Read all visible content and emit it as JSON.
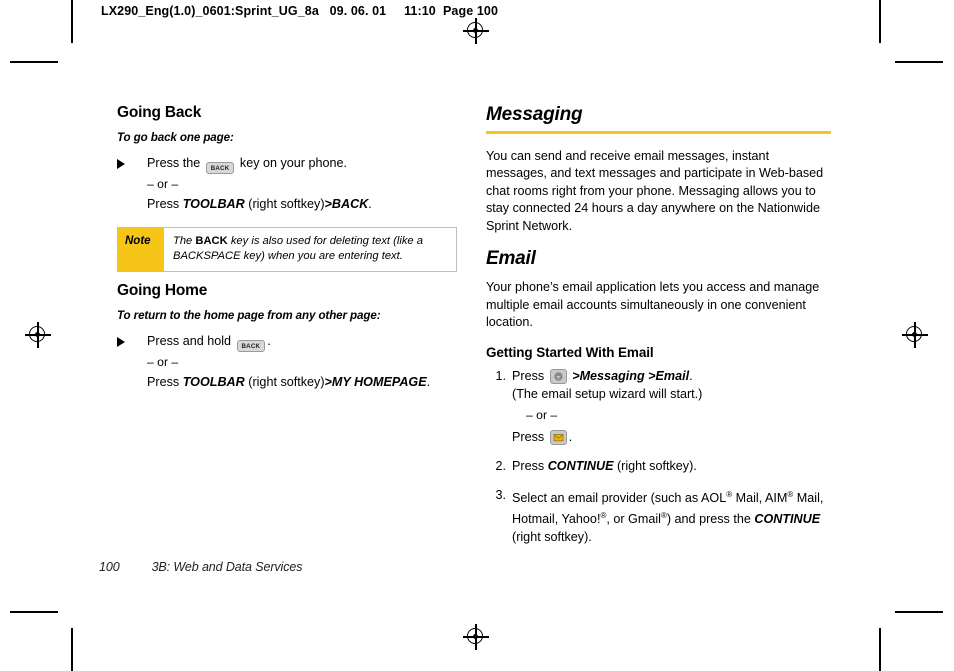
{
  "runhead": "LX290_Eng(1.0)_0601:Sprint_UG_8a   09. 06. 01     11:10  Page 100",
  "left_column": {
    "heading_going_back": "Going Back",
    "lead_going_back": "To go back one page:",
    "step1_pre": "Press the",
    "step1_key": "BACK",
    "step1_post": "key on your phone.",
    "or": "– or –",
    "step2_pre": "Press",
    "step2_italic1": "TOOLBAR",
    "step2_mid": "(right softkey)",
    "step2_gt": ">",
    "step2_italic2": "BACK",
    "step2_end": ".",
    "note": {
      "label": "Note",
      "text_1": "The ",
      "text_bold": "BACK",
      "text_2": " key is also used for deleting text (like a BACKSPACE key) when you are entering text."
    },
    "heading_going_home": "Going Home",
    "lead_going_home": "To return to the home page from any other page:",
    "home_step1_pre": "Press and hold",
    "home_step1_key": "BACK",
    "home_step1_post": ".",
    "home_step2_pre": "Press",
    "home_step2_italic1": "TOOLBAR",
    "home_step2_mid": "(right softkey)",
    "home_step2_gt": ">",
    "home_step2_italic2": "MY HOMEPAGE",
    "home_step2_end": "."
  },
  "right_column": {
    "heading_messaging": "Messaging",
    "messaging_body": "You can send and receive email messages, instant messages, and text messages and participate in Web-based chat rooms right from your phone. Messaging allows you to stay connected 24 hours a day anywhere on the Nationwide Sprint Network.",
    "heading_email": "Email",
    "email_body": "Your phone’s email application lets you access and manage multiple email accounts simultaneously in one convenient location.",
    "heading_getting_started": "Getting Started With Email",
    "steps": [
      {
        "num": "1.",
        "pre": "Press",
        "icon": "menu-key-icon",
        "gt1": ">",
        "italic1": "Messaging",
        "gt2": ">",
        "italic2": "Email",
        "end": ".",
        "line2": "(The email setup wizard will start.)",
        "or": "– or –",
        "line3_pre": "Press",
        "line3_icon": "email-key-icon",
        "line3_end": "."
      },
      {
        "num": "2.",
        "pre": "Press",
        "italic1": "CONTINUE",
        "post": "(right softkey)."
      },
      {
        "num": "3.",
        "text_a": "Select an email provider (such as AOL",
        "sup_a": "®",
        "text_b": " Mail, AIM",
        "sup_b": "®",
        "text_c": " Mail, Hotmail, Yahoo!",
        "sup_c": "®",
        "text_d": ", or Gmail",
        "sup_d": "®",
        "text_e": ") and press the ",
        "italic1": "CONTINUE",
        "text_f": " (right softkey)."
      }
    ]
  },
  "footer": {
    "page_number": "100",
    "section": "3B: Web and Data Services"
  },
  "colors": {
    "accent_yellow": "#f5c518",
    "text": "#000000",
    "note_border": "#bfbfbf"
  }
}
